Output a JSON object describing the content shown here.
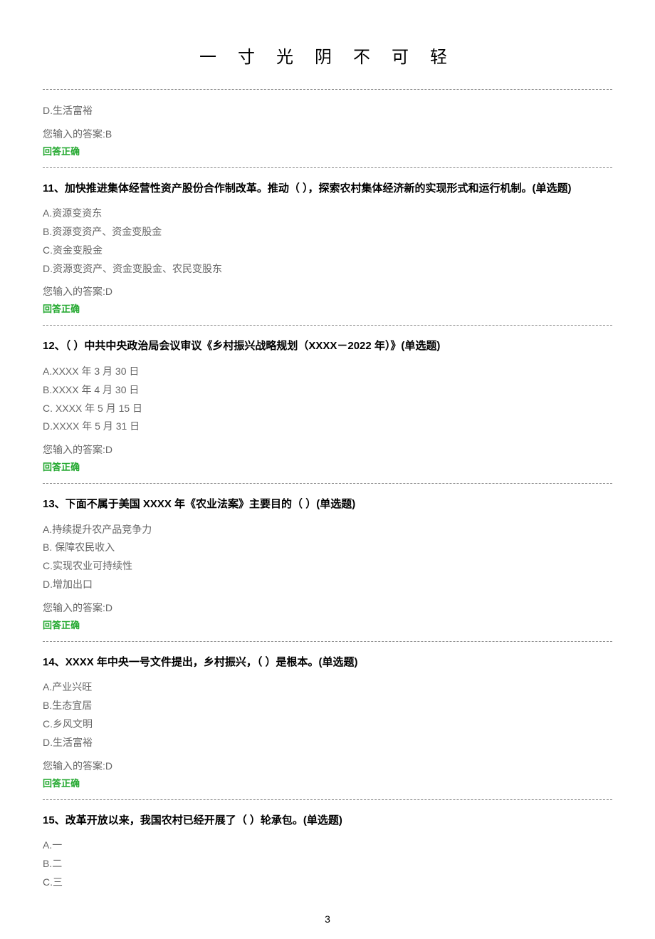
{
  "header": {
    "title": "一 寸 光 阴 不 可 轻"
  },
  "top_fragment": {
    "option": "D.生活富裕",
    "your_answer": "您输入的答案:B",
    "feedback": "回答正确"
  },
  "questions": [
    {
      "num": "11、",
      "stem": "加快推进集体经营性资产股份合作制改革。推动（ ），探索农村集体经济新的实现形式和运行机制。",
      "qtype": "(单选题)",
      "options": [
        "A.资源变资东",
        "B.资源变资产、资金变股金",
        "C.资金变股金",
        "D.资源变资产、资金变股金、农民变股东"
      ],
      "your_answer": "您输入的答案:D",
      "feedback": "回答正确"
    },
    {
      "num": "12、",
      "stem": "（ ）中共中央政治局会议审议《乡村振兴战略规划（XXXX－2022 年）》",
      "qtype": "(单选题)",
      "options": [
        "A.XXXX 年 3 月 30 日",
        "B.XXXX 年 4 月 30 日",
        "C. XXXX 年 5 月 15 日",
        "D.XXXX 年 5 月 31 日"
      ],
      "your_answer": "您输入的答案:D",
      "feedback": "回答正确"
    },
    {
      "num": "13、",
      "stem": "下面不属于美国 XXXX 年《农业法案》主要目的（ ）",
      "qtype": "(单选题)",
      "options": [
        "A.持续提升农产品竞争力",
        "B.  保障农民收入",
        "C.实现农业可持续性",
        "D.增加出口"
      ],
      "your_answer": "您输入的答案:D",
      "feedback": "回答正确"
    },
    {
      "num": "14、",
      "stem": "XXXX 年中央一号文件提出，乡村振兴，（ ）是根本。",
      "qtype": "(单选题)",
      "options": [
        "A.产业兴旺",
        "B.生态宜居",
        "C.乡风文明",
        "D.生活富裕"
      ],
      "your_answer": "您输入的答案:D",
      "feedback": "回答正确"
    },
    {
      "num": "15、",
      "stem": "改革开放以来，我国农村已经开展了（ ）轮承包。",
      "qtype": "(单选题)",
      "options": [
        "A.一",
        "B.二",
        "C.三"
      ],
      "your_answer": "",
      "feedback": ""
    }
  ],
  "page_number": "3"
}
